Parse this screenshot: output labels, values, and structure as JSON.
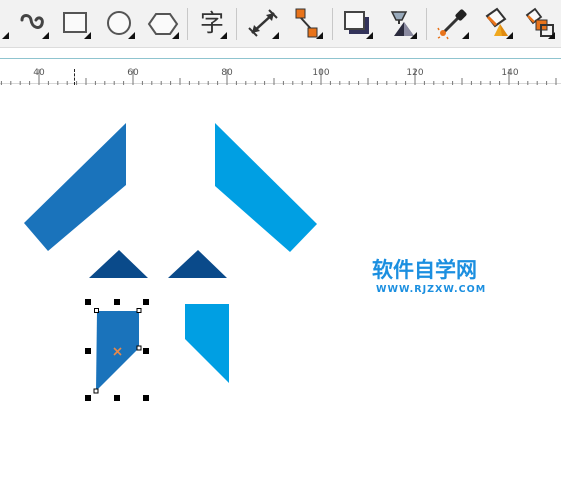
{
  "toolbar": {
    "tools": [
      {
        "name": "freehand-tool",
        "icon": "curve-icon"
      },
      {
        "name": "rectangle-tool",
        "icon": "rectangle-icon"
      },
      {
        "name": "ellipse-tool",
        "icon": "ellipse-icon"
      },
      {
        "name": "polygon-tool",
        "icon": "hexagon-icon"
      },
      {
        "name": "text-tool",
        "icon": "text-icon",
        "glyph": "字"
      },
      {
        "name": "dimension-tool",
        "icon": "dimension-icon"
      },
      {
        "name": "connector-tool",
        "icon": "connector-icon"
      },
      {
        "name": "drop-shadow-tool",
        "icon": "shadow-icon"
      },
      {
        "name": "transparency-tool",
        "icon": "transparency-icon"
      },
      {
        "name": "eyedropper-tool",
        "icon": "eyedropper-icon"
      },
      {
        "name": "fill-tool",
        "icon": "paint-bucket-icon"
      },
      {
        "name": "smart-fill-tool",
        "icon": "smart-fill-icon"
      }
    ]
  },
  "ruler": {
    "labels": [
      "40",
      "60",
      "80",
      "100",
      "120",
      "140"
    ]
  },
  "canvas": {
    "colors": {
      "dark_blue": "#1a73bb",
      "light_blue": "#009fe3",
      "navy": "#0a4a8a",
      "handle": "#000000",
      "center_mark": "#e8894a"
    },
    "selected_object": "left-lower-shape"
  },
  "watermark": {
    "title": "软件自学网",
    "url": "WWW.RJZXW.COM",
    "color": "#1b8fe0"
  }
}
